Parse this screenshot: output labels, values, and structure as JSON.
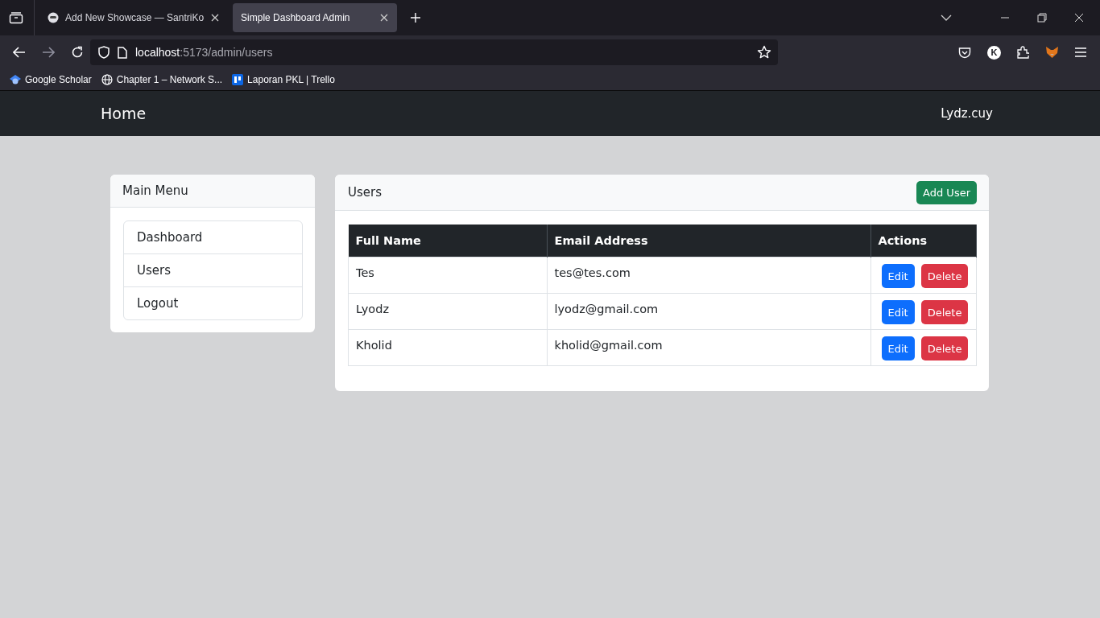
{
  "browser": {
    "tabs": [
      {
        "title": "Add New Showcase — SantriKo",
        "selected": false
      },
      {
        "title": "Simple Dashboard Admin",
        "selected": true
      }
    ],
    "address": {
      "host": "localhost",
      "path": ":5173/admin/users"
    },
    "bookmarks": [
      {
        "kind": "scholar",
        "label": "Google Scholar"
      },
      {
        "kind": "globe",
        "label": "Chapter 1 – Network S..."
      },
      {
        "kind": "trello",
        "label": "Laporan PKL | Trello"
      }
    ],
    "profile_initial": "K"
  },
  "navbar": {
    "brand": "Home",
    "user": "Lydz.cuy"
  },
  "sidebar": {
    "title": "Main Menu",
    "items": [
      {
        "label": "Dashboard"
      },
      {
        "label": "Users"
      },
      {
        "label": "Logout"
      }
    ]
  },
  "users": {
    "title": "Users",
    "add_button": "Add User",
    "columns": [
      "Full Name",
      "Email Address",
      "Actions"
    ],
    "rows": [
      {
        "name": "Tes",
        "email": "tes@tes.com",
        "edit": "Edit",
        "delete": "Delete"
      },
      {
        "name": "Lyodz",
        "email": "lyodz@gmail.com",
        "edit": "Edit",
        "delete": "Delete"
      },
      {
        "name": "Kholid",
        "email": "kholid@gmail.com",
        "edit": "Edit",
        "delete": "Delete"
      }
    ]
  }
}
